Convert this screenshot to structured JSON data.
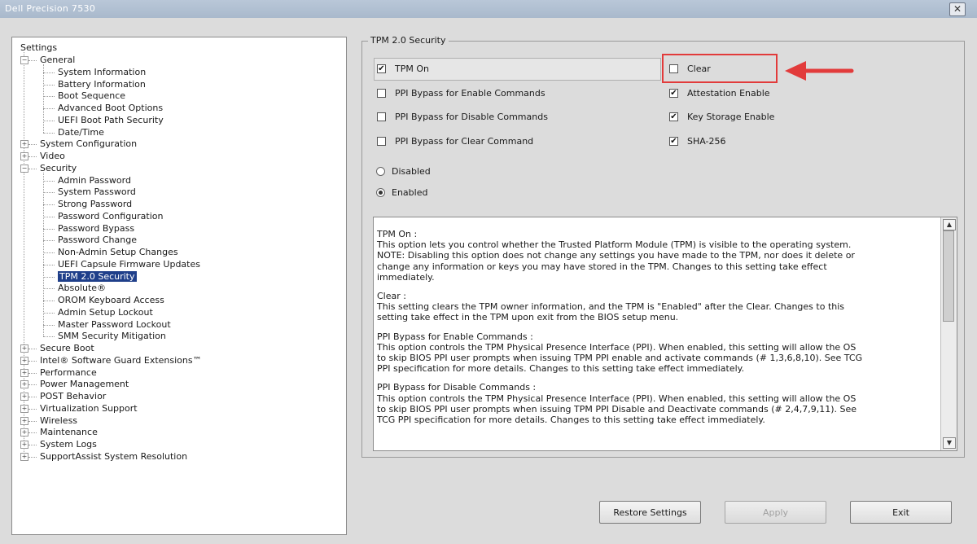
{
  "window": {
    "title": "Dell Precision 7530",
    "close_glyph": "✕"
  },
  "tree": {
    "root": "Settings",
    "items": [
      {
        "label": "General",
        "level": 1,
        "expander": "−"
      },
      {
        "label": "System Information",
        "level": 2
      },
      {
        "label": "Battery Information",
        "level": 2
      },
      {
        "label": "Boot Sequence",
        "level": 2
      },
      {
        "label": "Advanced Boot Options",
        "level": 2
      },
      {
        "label": "UEFI Boot Path Security",
        "level": 2
      },
      {
        "label": "Date/Time",
        "level": 2
      },
      {
        "label": "System Configuration",
        "level": 1,
        "expander": "+"
      },
      {
        "label": "Video",
        "level": 1,
        "expander": "+"
      },
      {
        "label": "Security",
        "level": 1,
        "expander": "−"
      },
      {
        "label": "Admin Password",
        "level": 2
      },
      {
        "label": "System Password",
        "level": 2
      },
      {
        "label": "Strong Password",
        "level": 2
      },
      {
        "label": "Password Configuration",
        "level": 2
      },
      {
        "label": "Password Bypass",
        "level": 2
      },
      {
        "label": "Password Change",
        "level": 2
      },
      {
        "label": "Non-Admin Setup Changes",
        "level": 2
      },
      {
        "label": "UEFI Capsule Firmware Updates",
        "level": 2
      },
      {
        "label": "TPM 2.0 Security",
        "level": 2,
        "selected": true
      },
      {
        "label": "Absolute®",
        "level": 2
      },
      {
        "label": "OROM Keyboard Access",
        "level": 2
      },
      {
        "label": "Admin Setup Lockout",
        "level": 2
      },
      {
        "label": "Master Password Lockout",
        "level": 2
      },
      {
        "label": "SMM Security Mitigation",
        "level": 2
      },
      {
        "label": "Secure Boot",
        "level": 1,
        "expander": "+"
      },
      {
        "label": "Intel® Software Guard Extensions™",
        "level": 1,
        "expander": "+"
      },
      {
        "label": "Performance",
        "level": 1,
        "expander": "+"
      },
      {
        "label": "Power Management",
        "level": 1,
        "expander": "+"
      },
      {
        "label": "POST Behavior",
        "level": 1,
        "expander": "+"
      },
      {
        "label": "Virtualization Support",
        "level": 1,
        "expander": "+"
      },
      {
        "label": "Wireless",
        "level": 1,
        "expander": "+"
      },
      {
        "label": "Maintenance",
        "level": 1,
        "expander": "+"
      },
      {
        "label": "System Logs",
        "level": 1,
        "expander": "+"
      },
      {
        "label": "SupportAssist System Resolution",
        "level": 1,
        "expander": "+"
      }
    ]
  },
  "tpm": {
    "group_title": "TPM 2.0 Security",
    "checkboxes": [
      {
        "id": "tpm-on",
        "label": "TPM On",
        "checked": true
      },
      {
        "id": "clear",
        "label": "Clear",
        "checked": false
      },
      {
        "id": "ppi-enable",
        "label": "PPI Bypass for Enable Commands",
        "checked": false
      },
      {
        "id": "attestation",
        "label": "Attestation Enable",
        "checked": true
      },
      {
        "id": "ppi-disable",
        "label": "PPI Bypass for Disable Commands",
        "checked": false
      },
      {
        "id": "key-storage",
        "label": "Key Storage Enable",
        "checked": true
      },
      {
        "id": "ppi-clear",
        "label": "PPI Bypass for Clear Command",
        "checked": false
      },
      {
        "id": "sha256",
        "label": "SHA-256",
        "checked": true
      }
    ],
    "radios": [
      {
        "label": "Disabled",
        "selected": false
      },
      {
        "label": "Enabled",
        "selected": true
      }
    ]
  },
  "description": {
    "paragraphs": [
      [
        "TPM On :",
        "This option lets you control whether the Trusted Platform Module (TPM) is visible to the operating system.",
        "NOTE: Disabling this option does not change any settings you have made to the TPM, nor does it delete or",
        "change any information or keys you may have stored in the TPM.  Changes to this setting take effect",
        "immediately."
      ],
      [
        "Clear :",
        "This setting clears the TPM owner information, and the TPM is \"Enabled\" after the Clear.  Changes to this",
        "setting take effect in the TPM upon exit from the BIOS setup menu."
      ],
      [
        "PPI Bypass for Enable Commands :",
        "This option controls the TPM Physical Presence Interface (PPI). When enabled, this setting will allow the OS",
        "to skip BIOS PPI user prompts when issuing TPM PPI enable and activate commands (# 1,3,6,8,10).  See TCG",
        "PPI specification for more details. Changes to this setting take effect immediately."
      ],
      [
        "PPI Bypass for Disable Commands :",
        "This option controls the TPM Physical Presence Interface (PPI). When enabled, this setting will allow the OS",
        "to skip BIOS PPI user prompts when issuing TPM PPI Disable and Deactivate commands (# 2,4,7,9,11).  See",
        "TCG PPI specification for more details.  Changes to this setting take effect immediately."
      ]
    ],
    "scroll_up_glyph": "▲",
    "scroll_down_glyph": "▼"
  },
  "buttons": {
    "restore": "Restore Settings",
    "apply": "Apply",
    "exit": "Exit"
  },
  "annotation": {
    "color": "#e23b3b"
  }
}
